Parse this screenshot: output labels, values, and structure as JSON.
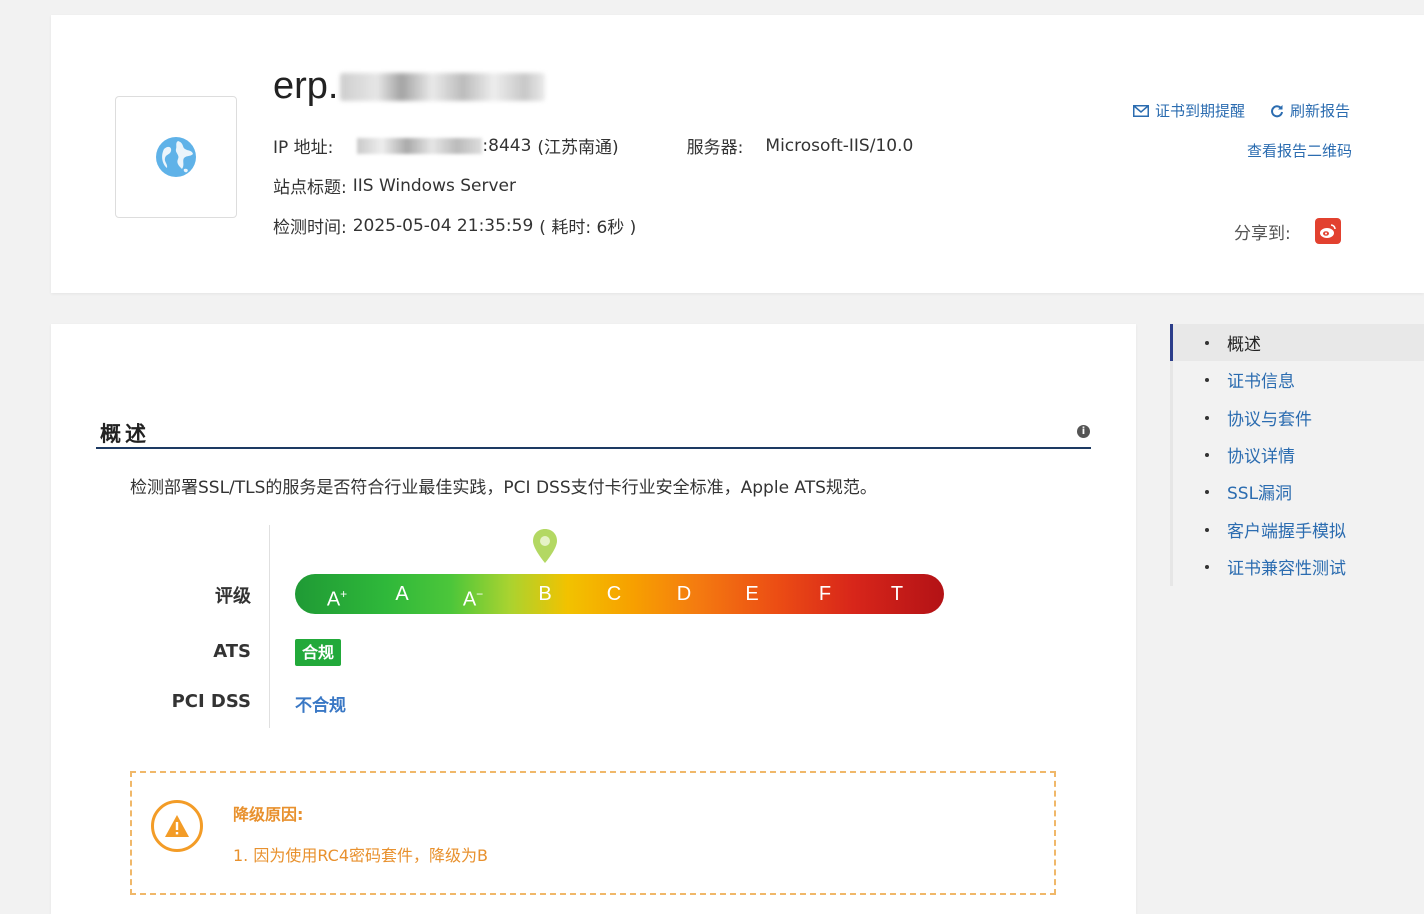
{
  "header": {
    "domain_visible": "erp.",
    "ip": {
      "label": "IP 地址:",
      "port_suffix": ":8443",
      "location": "(江苏南通)"
    },
    "server": {
      "label": "服务器:",
      "value": "Microsoft-IIS/10.0"
    },
    "site_title": {
      "label": "站点标题:",
      "value": "IIS Windows Server"
    },
    "scan_time": {
      "label": "检测时间:",
      "value": "2025-05-04 21:35:59",
      "duration": "( 耗时: 6秒 )"
    },
    "links": {
      "expiry_reminder": "证书到期提醒",
      "refresh_report": "刷新报告",
      "report_qr": "查看报告二维码"
    },
    "share_label": "分享到:"
  },
  "overview": {
    "title": "概述",
    "description": "检测部署SSL/TLS的服务是否符合行业最佳实践，PCI DSS支付卡行业安全标准，Apple ATS规范。",
    "grade_label": "评级",
    "grades": [
      {
        "letter": "A",
        "sup": "+"
      },
      {
        "letter": "A",
        "sup": ""
      },
      {
        "letter": "A",
        "sup": "−"
      },
      {
        "letter": "B",
        "sup": ""
      },
      {
        "letter": "C",
        "sup": ""
      },
      {
        "letter": "D",
        "sup": ""
      },
      {
        "letter": "E",
        "sup": ""
      },
      {
        "letter": "F",
        "sup": ""
      },
      {
        "letter": "T",
        "sup": ""
      }
    ],
    "current_grade": "B",
    "ats_label": "ATS",
    "ats_value": "合规",
    "pci_label": "PCI DSS",
    "pci_value": "不合规",
    "downgrade": {
      "title": "降级原因:",
      "items": [
        "1. 因为使用RC4密码套件，降级为B"
      ]
    }
  },
  "side_nav": {
    "items": [
      "概述",
      "证书信息",
      "协议与套件",
      "协议详情",
      "SSL漏洞",
      "客户端握手模拟",
      "证书兼容性测试"
    ],
    "active_index": 0
  },
  "colors": {
    "accent_link": "#2b6cb0",
    "nav_active_bar": "#2b3d8a",
    "ats_green": "#22a93a",
    "warning_orange": "#e8912e",
    "weibo_red": "#e2412f"
  }
}
